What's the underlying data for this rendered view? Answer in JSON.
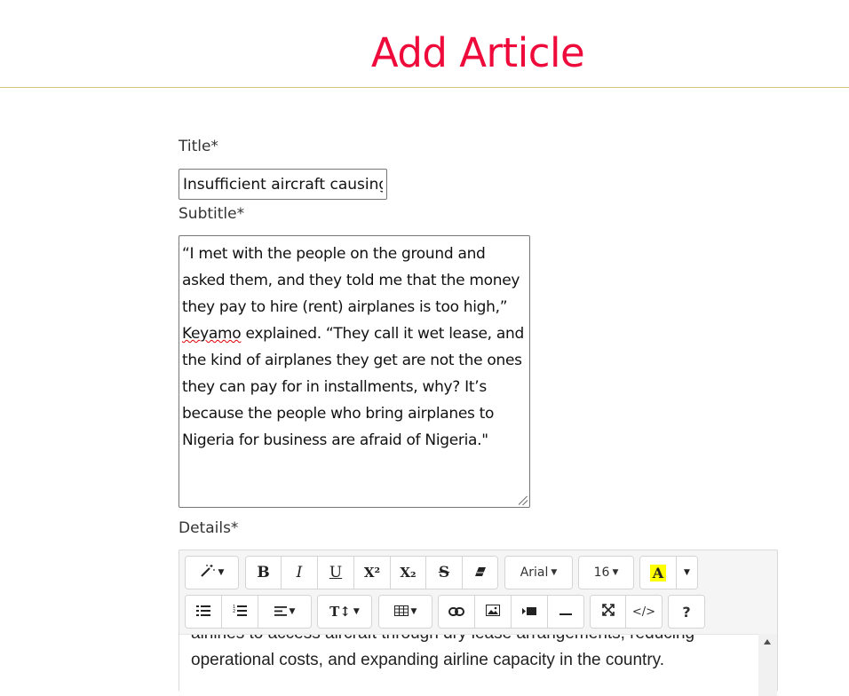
{
  "page": {
    "title": "Add Article"
  },
  "form": {
    "title_label": "Title*",
    "title_value": "Insufficient aircraft causing",
    "subtitle_label": "Subtitle*",
    "subtitle_part1": "“I met with the people on the ground and asked them, and they told me that the money they pay to hire (rent) airplanes is too high,” ",
    "subtitle_spell_word": "Keyamo",
    "subtitle_part2": " explained. “They call it wet lease, and the kind of airplanes they get are not the ones they can pay for in installments, why? It’s because the people who bring airplanes to Nigeria for business are afraid of Nigeria.\"",
    "details_label": "Details*"
  },
  "editor": {
    "toolbar": {
      "style_icon": "magic-wand-icon",
      "bold": "B",
      "italic": "I",
      "underline": "U",
      "superscript": "X²",
      "subscript": "X₂",
      "strikethrough": "S",
      "eraser_icon": "eraser-icon",
      "font_name": "Arial",
      "font_size": "16",
      "color_letter": "A",
      "color_highlight": "#ffff00",
      "unordered_list_icon": "unordered-list-icon",
      "ordered_list_icon": "ordered-list-icon",
      "align_icon": "align-icon",
      "height_label": "T↕",
      "table_icon": "table-icon",
      "link_icon": "link-icon",
      "picture_icon": "picture-icon",
      "video_icon": "video-icon",
      "hr_icon": "horizontal-rule-icon",
      "fullscreen_icon": "fullscreen-icon",
      "codeview": "</>",
      "help": "?"
    },
    "content": "airlines to access aircraft through dry lease arrangements, reducing operational costs, and expanding airline capacity in the country."
  },
  "colors": {
    "title": "#ee0a3a",
    "header_rule": "#d6c67a"
  }
}
